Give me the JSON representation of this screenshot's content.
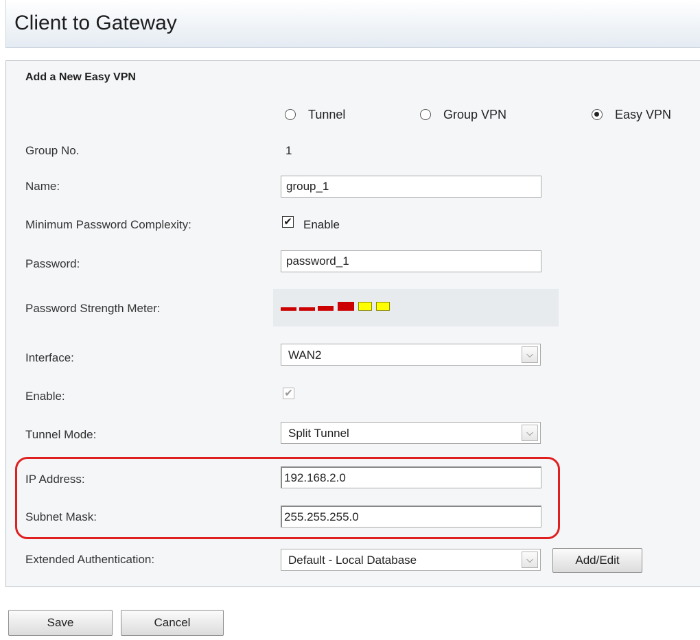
{
  "page": {
    "title": "Client to Gateway"
  },
  "section": {
    "title": "Add a New Easy VPN"
  },
  "mode_options": [
    {
      "label": "Tunnel",
      "selected": false
    },
    {
      "label": "Group VPN",
      "selected": false
    },
    {
      "label": "Easy VPN",
      "selected": true
    }
  ],
  "form": {
    "group_no": {
      "label": "Group No.",
      "value": "1"
    },
    "name": {
      "label": "Name:",
      "value": "group_1"
    },
    "min_password_complexity": {
      "label": "Minimum Password Complexity:",
      "checkbox_label": "Enable",
      "checked": true
    },
    "password": {
      "label": "Password:",
      "value": "password_1"
    },
    "password_strength": {
      "label": "Password Strength Meter:",
      "segments": [
        "#cc0000",
        "#cc0000",
        "#cc0000",
        "#cc0000",
        "#ffff00",
        "#ffff00"
      ]
    },
    "interface": {
      "label": "Interface:",
      "selected": "WAN2"
    },
    "enable": {
      "label": "Enable:",
      "checked": true,
      "disabled": true
    },
    "tunnel_mode": {
      "label": "Tunnel Mode:",
      "selected": "Split Tunnel"
    },
    "ip_address": {
      "label": "IP Address:",
      "value": "192.168.2.0"
    },
    "subnet_mask": {
      "label": "Subnet Mask:",
      "value": "255.255.255.0"
    },
    "extended_auth": {
      "label": "Extended Authentication:",
      "selected": "Default - Local Database",
      "add_edit_label": "Add/Edit"
    }
  },
  "buttons": {
    "save": "Save",
    "cancel": "Cancel"
  },
  "colors": {
    "highlight": "#e02020",
    "panel_bg": "#f4f6f8",
    "title_gradient_end": "#e4ebf2"
  }
}
